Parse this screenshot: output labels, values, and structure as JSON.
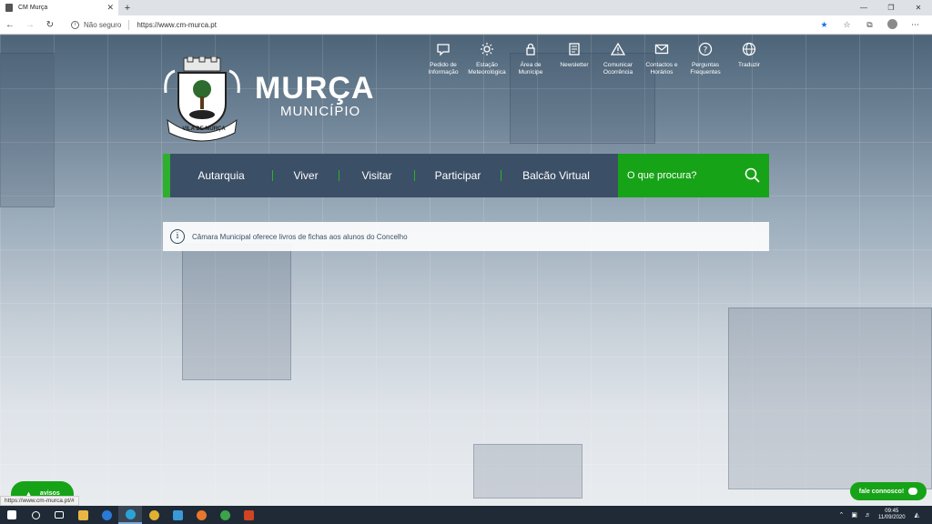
{
  "browser": {
    "tab_title": "CM Murça",
    "tab_close": "✕",
    "new_tab": "+",
    "security_label": "Não seguro",
    "url": "https://www.cm-murca.pt",
    "status_url": "https://www.cm-murca.pt/#"
  },
  "brand": {
    "name": "MURÇA",
    "subtitle": "MUNICÍPIO",
    "crest_banner": "VILA DE MURÇA"
  },
  "services": [
    {
      "icon": "speech-bubble-icon",
      "label": "Pedido de Informação"
    },
    {
      "icon": "sun-icon",
      "label": "Estação Meteorológica"
    },
    {
      "icon": "lock-icon",
      "label": "Área de Munícipe"
    },
    {
      "icon": "newsletter-icon",
      "label": "Newsletter"
    },
    {
      "icon": "warning-icon",
      "label": "Comunicar Ocorrência"
    },
    {
      "icon": "envelope-icon",
      "label": "Contactos e Horários"
    },
    {
      "icon": "question-icon",
      "label": "Perguntas Frequentes"
    },
    {
      "icon": "globe-icon",
      "label": "Traduzir"
    }
  ],
  "nav": {
    "items": [
      "Autarquia",
      "Viver",
      "Visitar",
      "Participar",
      "Balcão Virtual"
    ],
    "search_placeholder": "O que procura?"
  },
  "ticker": {
    "text": "Câmara Municipal oferece livros de fichas aos alunos do Concelho"
  },
  "floating": {
    "avisos": "avisos",
    "fale": "fale connosco!"
  },
  "taskbar": {
    "time": "09:45",
    "date": "11/09/2020"
  },
  "colors": {
    "nav_bg": "#3b4f66",
    "accent_green": "#17a317",
    "nav_separator": "#2db02d"
  }
}
